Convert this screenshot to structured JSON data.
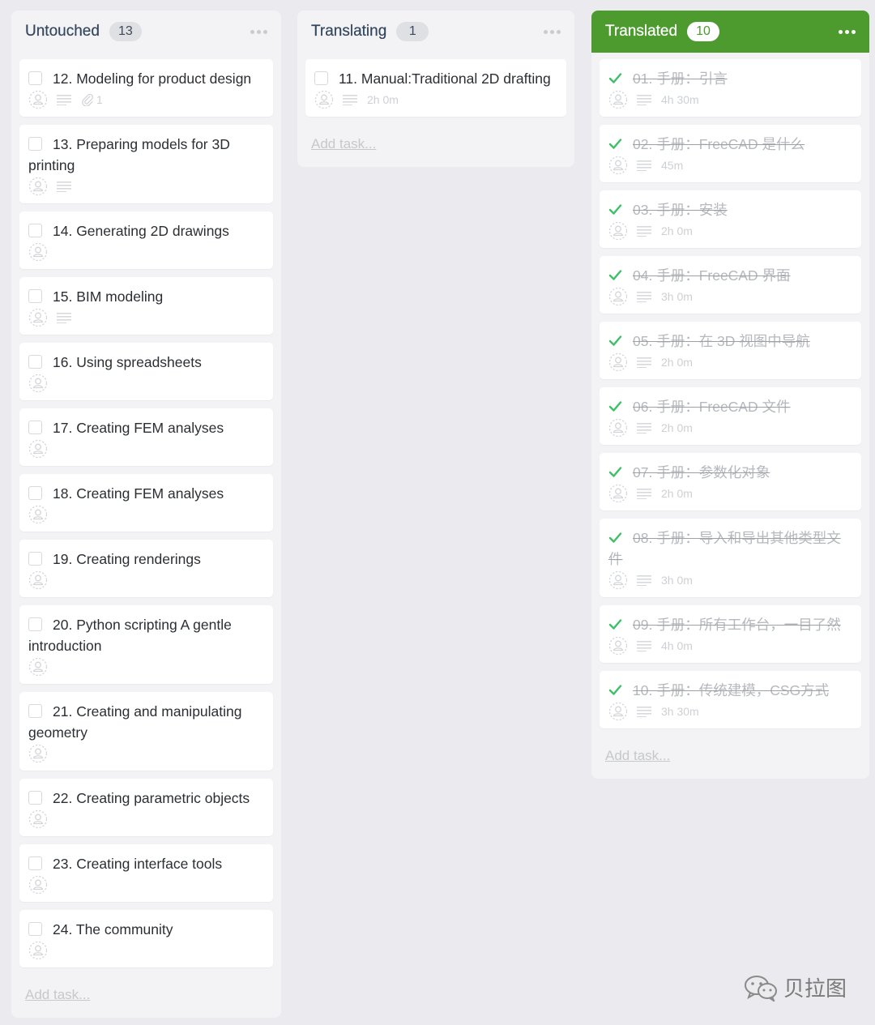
{
  "columns": [
    {
      "title": "Untouched",
      "count": "13",
      "add_task": "Add task...",
      "cards": [
        {
          "title": "12. Modeling for product design",
          "desc": true,
          "attachments": "1"
        },
        {
          "title": "13. Preparing models for 3D printing",
          "desc": true
        },
        {
          "title": "14. Generating 2D drawings"
        },
        {
          "title": "15. BIM modeling",
          "desc": true
        },
        {
          "title": "16. Using spreadsheets"
        },
        {
          "title": "17. Creating FEM analyses"
        },
        {
          "title": "18. Creating FEM analyses"
        },
        {
          "title": "19. Creating renderings"
        },
        {
          "title": "20. Python scripting A gentle introduction"
        },
        {
          "title": "21. Creating and manipulating geometry"
        },
        {
          "title": "22. Creating parametric objects"
        },
        {
          "title": "23. Creating interface tools"
        },
        {
          "title": "24. The community"
        }
      ]
    },
    {
      "title": "Translating",
      "count": "1",
      "add_task": "Add task...",
      "cards": [
        {
          "title": "11. Manual:Traditional 2D drafting",
          "desc": true,
          "time": "2h 0m"
        }
      ]
    },
    {
      "title": "Translated",
      "count": "10",
      "add_task": "Add task...",
      "done": true,
      "cards": [
        {
          "title": "01. 手册：引言",
          "desc": true,
          "time": "4h 30m"
        },
        {
          "title": "02. 手册：FreeCAD 是什么",
          "desc": true,
          "time": "45m"
        },
        {
          "title": "03. 手册：安装",
          "desc": true,
          "time": "2h 0m"
        },
        {
          "title": "04. 手册：FreeCAD 界面",
          "desc": true,
          "time": "3h 0m"
        },
        {
          "title": "05. 手册：在 3D 视图中导航",
          "desc": true,
          "time": "2h 0m"
        },
        {
          "title": "06. 手册：FreeCAD 文件",
          "desc": true,
          "time": "2h 0m"
        },
        {
          "title": "07. 手册：参数化对象",
          "desc": true,
          "time": "2h 0m"
        },
        {
          "title": "08. 手册：导入和导出其他类型文件",
          "desc": true,
          "time": "3h 0m"
        },
        {
          "title": "09. 手册：所有工作台，一目了然",
          "desc": true,
          "time": "4h 0m"
        },
        {
          "title": "10. 手册：传统建模，CSG方式",
          "desc": true,
          "time": "3h 30m"
        }
      ]
    }
  ],
  "colors": {
    "done_header": "#4d9a2f",
    "check": "#3fbf6a"
  },
  "watermark": {
    "text": "贝拉图",
    "icon": "wechat-icon"
  }
}
